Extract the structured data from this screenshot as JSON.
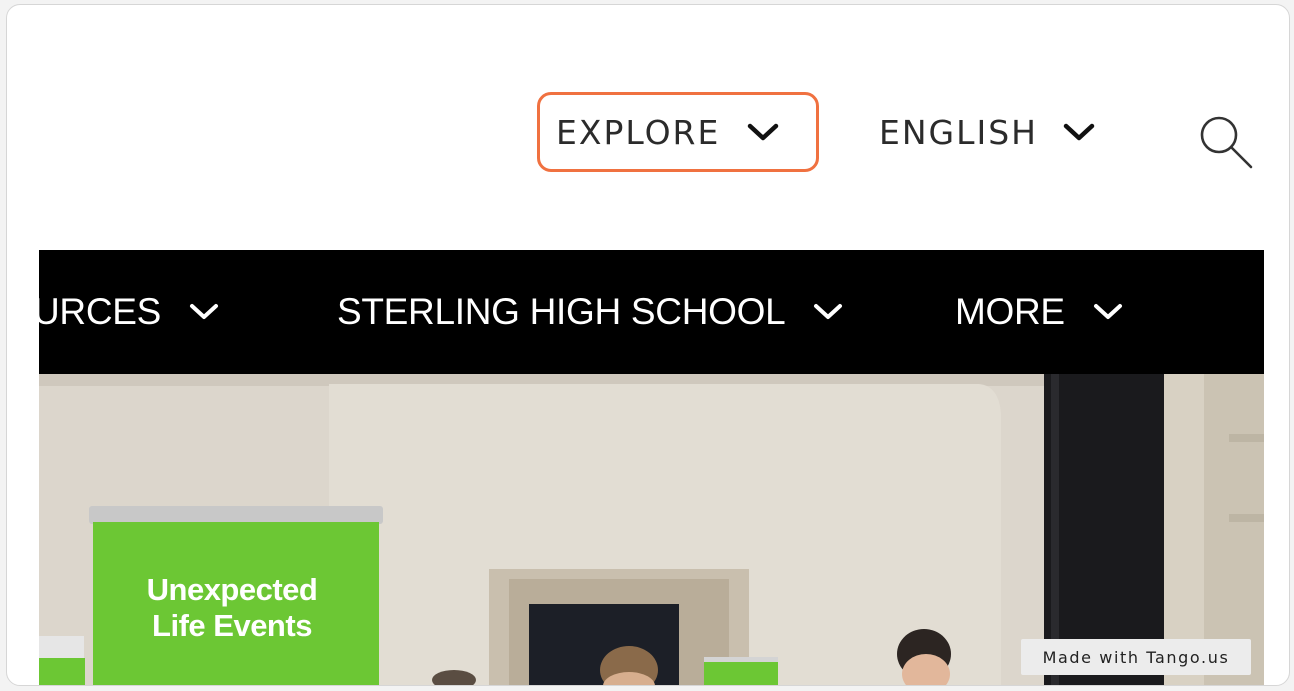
{
  "header": {
    "explore_label": "EXPLORE",
    "language_label": "ENGLISH"
  },
  "nav": {
    "items": [
      {
        "label": "URCES"
      },
      {
        "label": "STERLING HIGH SCHOOL"
      },
      {
        "label": "MORE"
      }
    ]
  },
  "hero": {
    "banner_text_line1": "Unexpected",
    "banner_text_line2": "Life Events"
  },
  "watermark": "Made with Tango.us",
  "colors": {
    "highlight": "#f07140",
    "navbar": "#000000",
    "banner_green": "#6cc734"
  }
}
